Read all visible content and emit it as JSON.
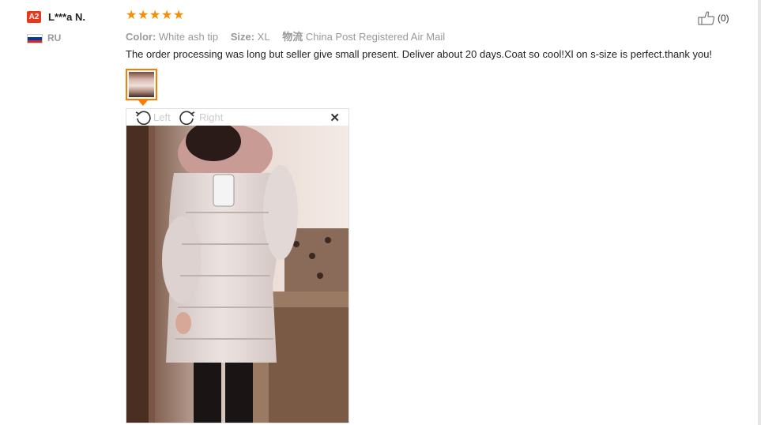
{
  "reviewer": {
    "badge": "A2",
    "name": "L***a N.",
    "country": "RU",
    "flag_colors": [
      "#ffffff",
      "#0039a6",
      "#d52b1e"
    ]
  },
  "rating": {
    "stars": 5,
    "max": 5,
    "color": "#ff8a00"
  },
  "attributes": [
    {
      "key": "Color:",
      "value": "White ash tip"
    },
    {
      "key": "Size:",
      "value": "XL"
    },
    {
      "key": "物流",
      "value": "China Post Registered Air Mail"
    }
  ],
  "review_text": "The order processing was long but seller give small present. Deliver about 20 days.Coat so cool!Xl on s-size is perfect.thank you!",
  "helpful": {
    "icon": "thumbs-up-icon",
    "count": "(0)"
  },
  "image_viewer": {
    "rotate_left_label": "Left",
    "rotate_right_label": "Right",
    "close_icon": "close-icon",
    "accent": "#ff7a00"
  }
}
